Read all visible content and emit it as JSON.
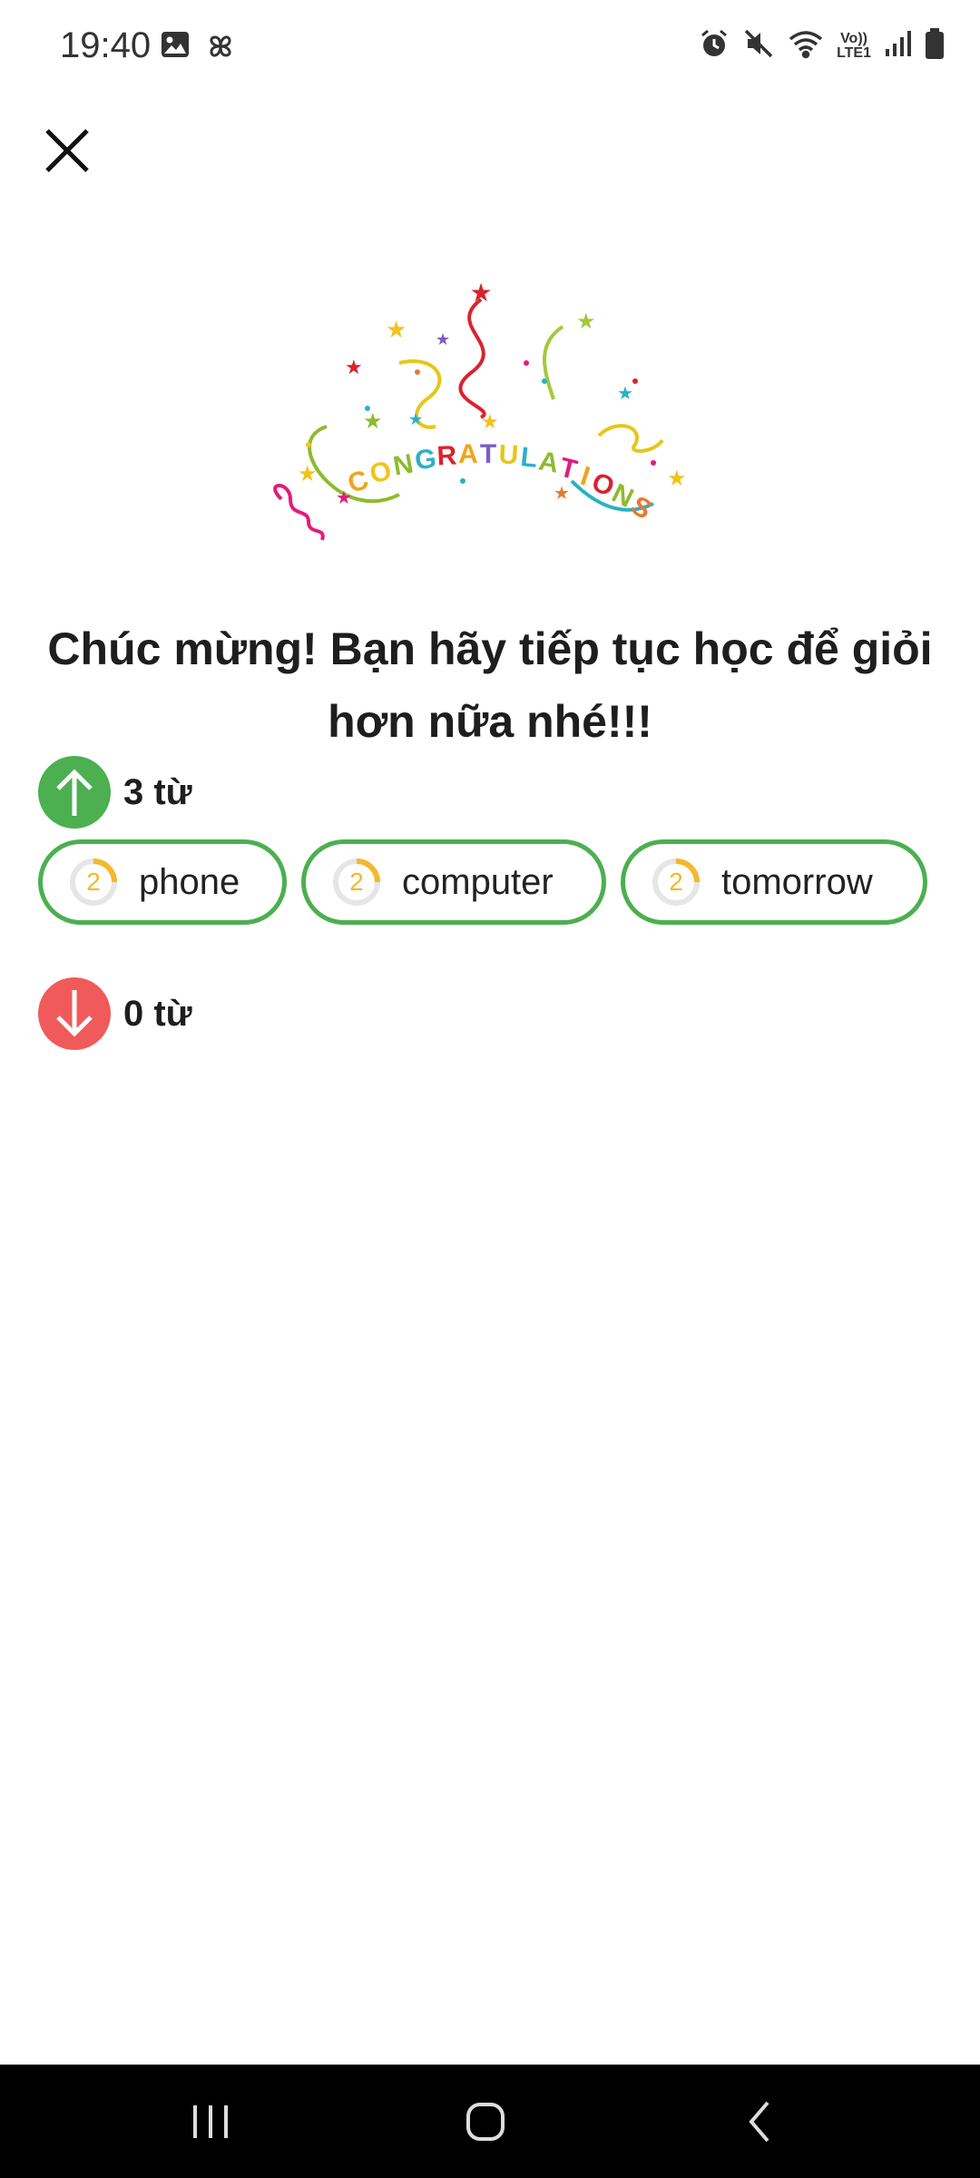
{
  "status_bar": {
    "time": "19:40",
    "network_label_top": "Vo))",
    "network_label_bottom": "LTE1",
    "icons": [
      "image-icon",
      "pinwheel-icon",
      "alarm-icon",
      "mute-icon",
      "wifi-icon",
      "signal-icon",
      "battery-icon"
    ]
  },
  "header": {
    "close_icon": "close-icon"
  },
  "celebration": {
    "banner_text": "CONGRATULATIONS"
  },
  "message": {
    "line1": "Chúc mừng! Bạn hãy tiếp tục học để giỏi",
    "line2": "hơn nữa nhé!!!"
  },
  "up_section": {
    "count_label": "3 từ",
    "color": "#4caf50",
    "words": [
      {
        "word": "phone",
        "level": "2"
      },
      {
        "word": "computer",
        "level": "2"
      },
      {
        "word": "tomorrow",
        "level": "2"
      }
    ]
  },
  "down_section": {
    "count_label": "0 từ",
    "color": "#f15a5a",
    "words": []
  },
  "colors": {
    "chip_border": "#4caf50",
    "level_ring": "#f3b82c",
    "nav_bg": "#000000"
  },
  "nav_bar": {
    "icons": [
      "recents-icon",
      "home-icon",
      "back-icon"
    ]
  }
}
